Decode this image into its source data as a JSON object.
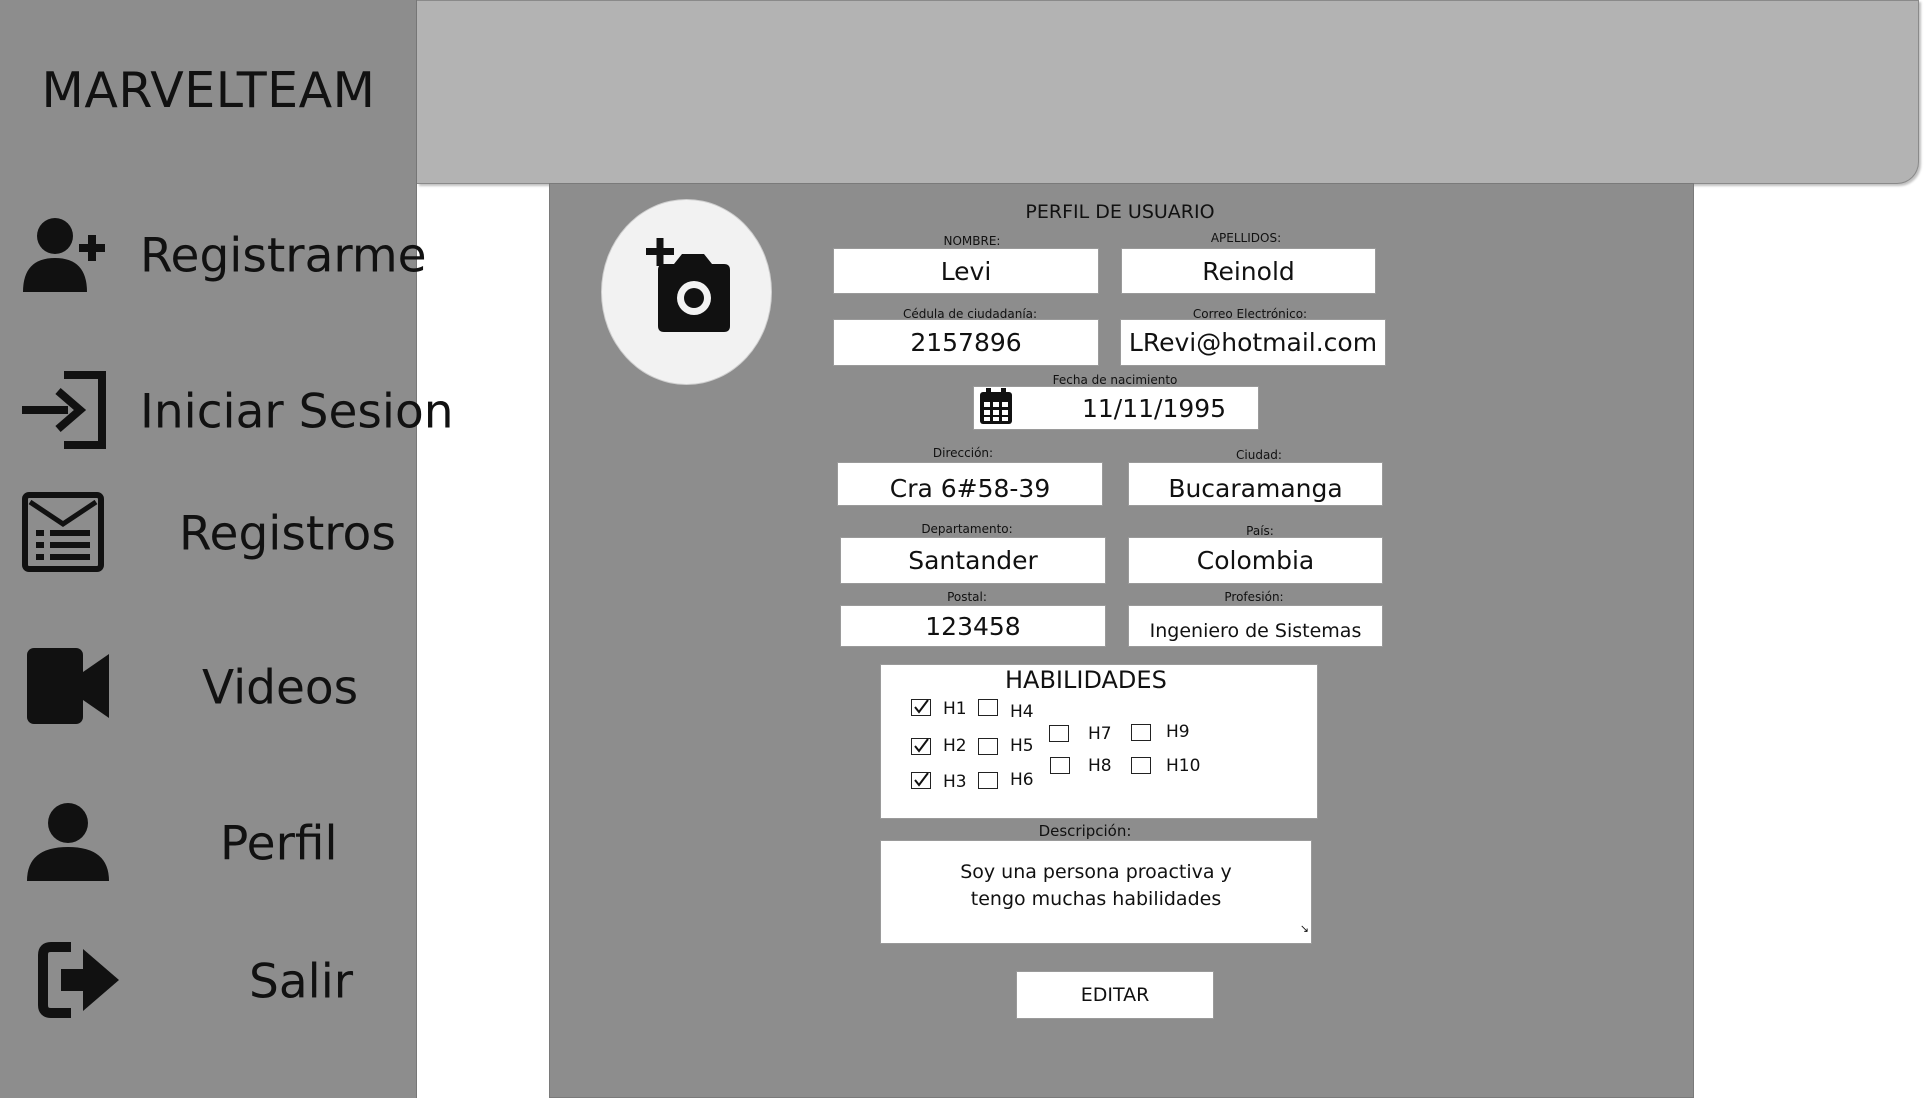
{
  "brand": "MARVELTEAM",
  "sidebar": {
    "items": [
      {
        "label": "Registrarme",
        "icon": "user-plus-icon"
      },
      {
        "label": "Iniciar Sesion",
        "icon": "sign-in-icon"
      },
      {
        "label": "Registros",
        "icon": "records-icon"
      },
      {
        "label": "Videos",
        "icon": "video-camera-icon"
      },
      {
        "label": "Perfil",
        "icon": "user-icon"
      },
      {
        "label": "Salir",
        "icon": "sign-out-icon"
      }
    ]
  },
  "profile": {
    "title": "PERFIL DE USUARIO",
    "avatar_icon": "add-photo-icon",
    "fields": {
      "nombre": {
        "label": "NOMBRE:",
        "value": "Levi"
      },
      "apellidos": {
        "label": "APELLIDOS:",
        "value": "Reinold"
      },
      "cedula": {
        "label": "Cédula de ciudadanía:",
        "value": "2157896"
      },
      "correo": {
        "label": "Correo Electrónico:",
        "value": "LRevi@hotmail.com"
      },
      "fecha": {
        "label": "Fecha de nacimiento",
        "value": "11/11/1995",
        "icon": "calendar-icon"
      },
      "direccion": {
        "label": "Dirección:",
        "value": "Cra 6#58-39"
      },
      "ciudad": {
        "label": "Ciudad:",
        "value": "Bucaramanga"
      },
      "departamento": {
        "label": "Departamento:",
        "value": "Santander"
      },
      "pais": {
        "label": "País:",
        "value": "Colombia"
      },
      "postal": {
        "label": "Postal:",
        "value": "123458"
      },
      "profesion": {
        "label": "Profesión:",
        "value": "Ingeniero de Sistemas"
      }
    },
    "skills": {
      "title": "HABILIDADES",
      "items": [
        {
          "label": "H1",
          "checked": true
        },
        {
          "label": "H2",
          "checked": true
        },
        {
          "label": "H3",
          "checked": true
        },
        {
          "label": "H4",
          "checked": false
        },
        {
          "label": "H5",
          "checked": false
        },
        {
          "label": "H6",
          "checked": false
        },
        {
          "label": "H7",
          "checked": false
        },
        {
          "label": "H8",
          "checked": false
        },
        {
          "label": "H9",
          "checked": false
        },
        {
          "label": "H10",
          "checked": false
        }
      ]
    },
    "description": {
      "label": "Descripción:",
      "lines": [
        "Soy una persona proactiva y",
        "tengo muchas habilidades"
      ]
    },
    "edit_label": "EDITAR"
  }
}
